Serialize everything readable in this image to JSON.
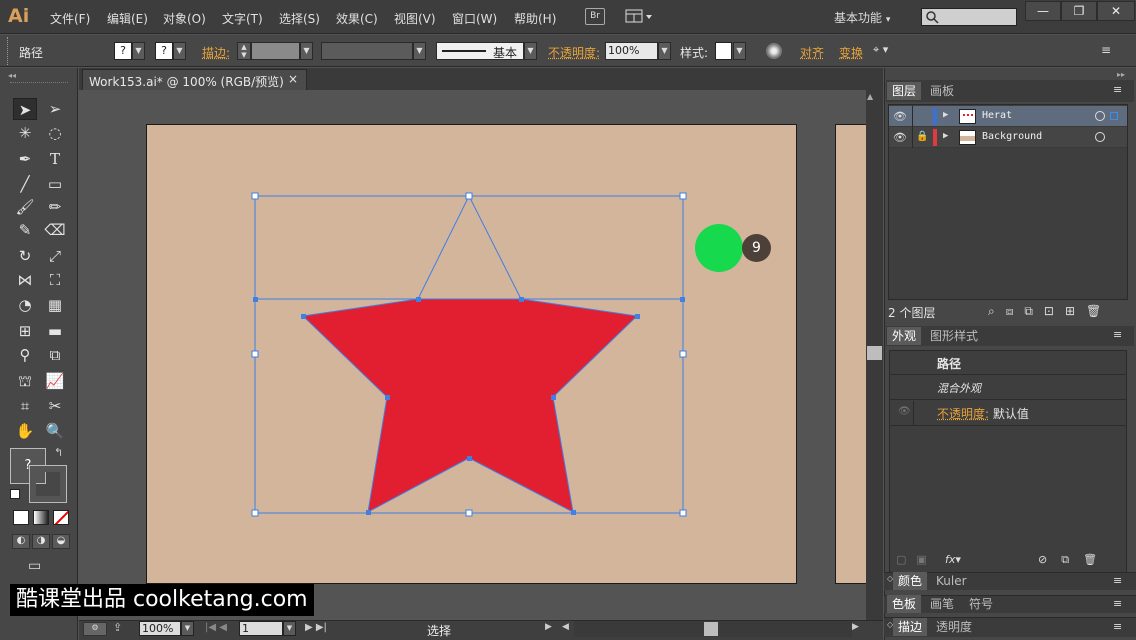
{
  "app": {
    "logo": "Ai"
  },
  "menu": [
    "文件(F)",
    "编辑(E)",
    "对象(O)",
    "文字(T)",
    "选择(S)",
    "效果(C)",
    "视图(V)",
    "窗口(W)",
    "帮助(H)"
  ],
  "bridge_label": "Br",
  "workspace": "基本功能",
  "window_controls": {
    "minimize": "—",
    "restore": "❐",
    "close": "✕"
  },
  "control_bar": {
    "selection_label": "路径",
    "fill_value": "?",
    "stroke_value": "?",
    "stroke_label": "描边:",
    "stroke_profile": "基本",
    "opacity_label": "不透明度:",
    "opacity_value": "100%",
    "style_label": "样式:",
    "align_label": "对齐",
    "transform_label": "变换"
  },
  "document": {
    "tab_title": "Work153.ai* @ 100% (RGB/预览)",
    "close": "×"
  },
  "canvas": {
    "artboard_color": "#d2b59b",
    "star_color": "#e21f30",
    "selection_color": "#3f7fe6"
  },
  "toolbar": {
    "fill_stroke_value": "?"
  },
  "status_bar": {
    "zoom": "100%",
    "artboard_num": "1",
    "tool_name": "选择"
  },
  "layers_panel": {
    "tabs": [
      "图层",
      "画板"
    ],
    "layers": [
      {
        "name": "Herat",
        "color": "#3b6fd9"
      },
      {
        "name": "Background",
        "color": "#e0393e"
      }
    ],
    "count_label": "2 个图层"
  },
  "appearance_panel": {
    "tabs": [
      "外观",
      "图形样式"
    ],
    "object_label": "路径",
    "mixed_label": "混合外观",
    "opacity_label": "不透明度:",
    "opacity_value": "默认值"
  },
  "collapsed_panels": [
    {
      "tabs": [
        "颜色",
        "Kuler"
      ]
    },
    {
      "tabs": [
        "色板",
        "画笔",
        "符号"
      ]
    },
    {
      "tabs": [
        "描边",
        "透明度"
      ]
    }
  ],
  "overlay": {
    "step_number": "9",
    "watermark": "酷课堂出品 coolketang.com"
  }
}
